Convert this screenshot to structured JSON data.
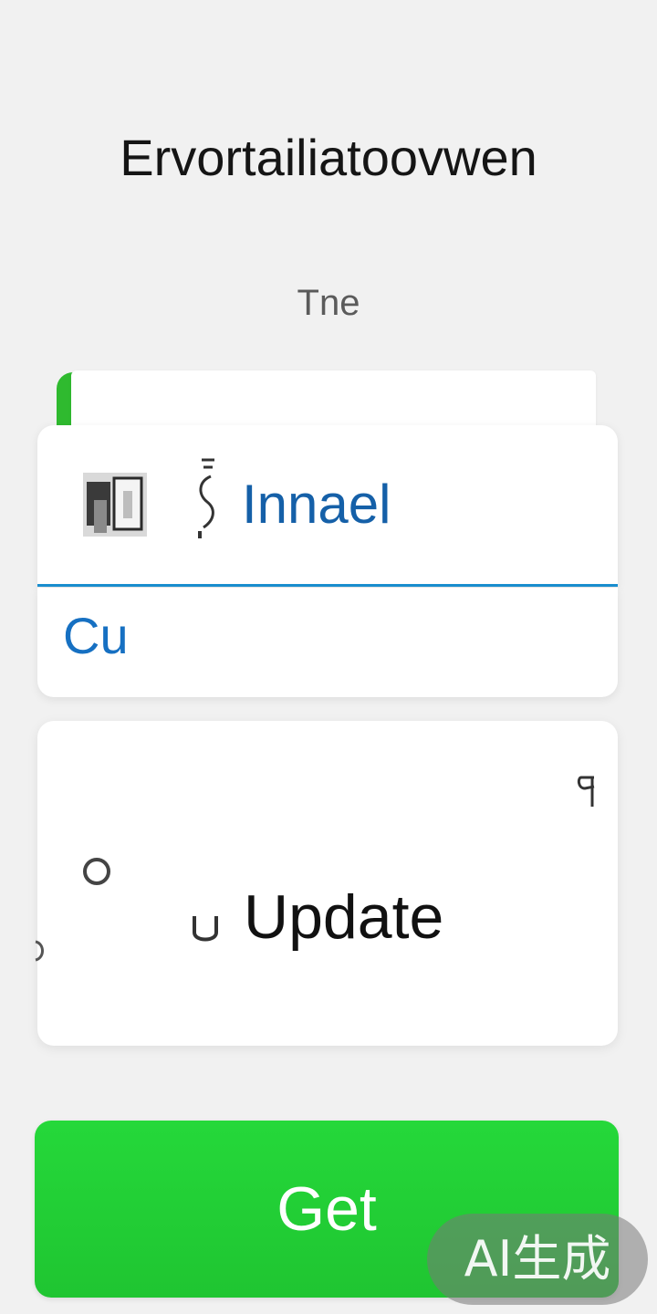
{
  "header": {
    "title": "Ervortailiatoovwen",
    "subtitle": "Tne"
  },
  "account": {
    "name": "Innael",
    "avatar_icon": "avatar-photo-icon",
    "glyph_icon": "squiggle-icon"
  },
  "input": {
    "value": "Cu"
  },
  "update_card": {
    "label": "Update",
    "icons": [
      "circle-icon",
      "corner-hook-icon",
      "update-u-icon"
    ]
  },
  "actions": {
    "primary_label": "Get"
  },
  "watermark": {
    "text": "AI生成"
  },
  "colors": {
    "background": "#f1f1f1",
    "accent_blue": "#1670c2",
    "primary_green": "#22cf36",
    "tab_green": "#2fba2f"
  }
}
